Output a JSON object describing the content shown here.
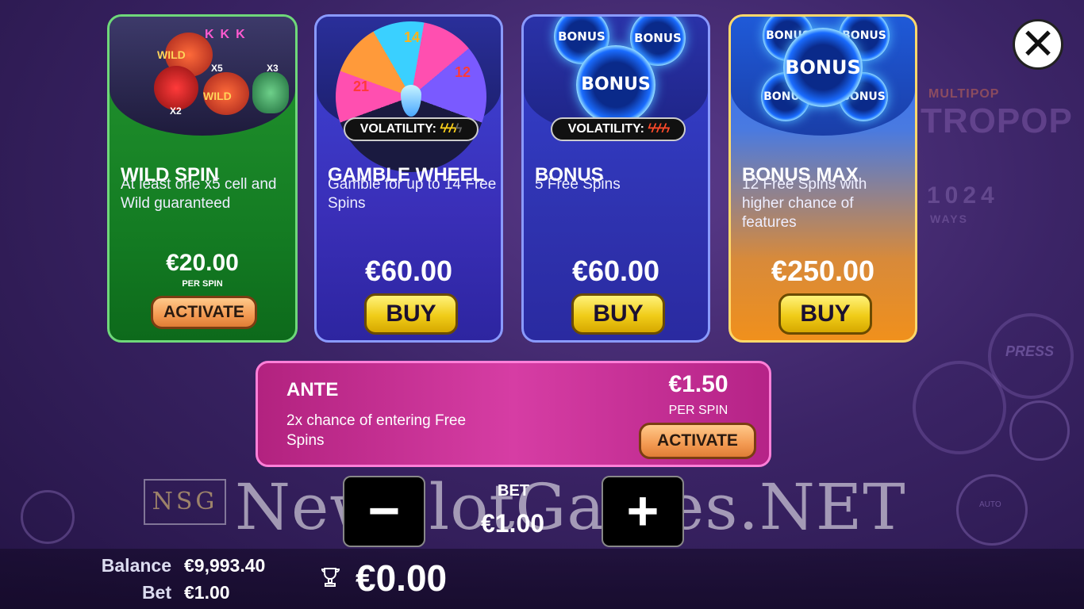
{
  "background": {
    "logo_top": "MULTIPOP",
    "logo_text": "TROPOP",
    "ways_number": "1024",
    "ways_label": "WAYS",
    "press_label": "PRESS",
    "auto_label": "AUTO"
  },
  "cards": [
    {
      "title": "WILD SPIN",
      "description": "At least one x5 cell and Wild guaranteed",
      "price": "€20.00",
      "price_sub": "PER SPIN",
      "button": "ACTIVATE",
      "art_labels": [
        "WILD",
        "WILD",
        "X5",
        "X3",
        "X2"
      ]
    },
    {
      "title": "GAMBLE WHEEL",
      "description": "Gamble for up to 14 Free Spins",
      "price": "€60.00",
      "button": "BUY",
      "volatility_label": "VOLATILITY:",
      "volatility_icon": "lightning-bolts-yellow",
      "volatility_level": 3.5,
      "wheel_labels": [
        "21",
        "14",
        "12"
      ]
    },
    {
      "title": "BONUS",
      "description": "5 Free Spins",
      "price": "€60.00",
      "button": "BUY",
      "volatility_label": "VOLATILITY:",
      "volatility_icon": "lightning-bolts-red",
      "volatility_level": 4,
      "chip_label": "BONUS"
    },
    {
      "title": "BONUS MAX",
      "description": "12 Free Spins with higher chance of features",
      "price": "€250.00",
      "button": "BUY",
      "chip_label": "BONUS"
    }
  ],
  "ante": {
    "title": "ANTE",
    "description": "2x chance of entering Free Spins",
    "price": "€1.50",
    "price_sub": "PER SPIN",
    "button": "ACTIVATE"
  },
  "bet_control": {
    "label": "BET",
    "value": "€1.00",
    "minus": "−",
    "plus": "+"
  },
  "footer": {
    "balance_label": "Balance",
    "balance_value": "€9,993.40",
    "bet_label": "Bet",
    "bet_value": "€1.00",
    "win_value": "€0.00",
    "win_icon": "trophy-icon"
  },
  "watermark": {
    "logo": "NSG",
    "text": "NewSlotGames.NET"
  },
  "colors": {
    "wild_card": "#1d8a2a",
    "gamble_card": "#3a3bc8",
    "bonus_card": "#2e3ab8",
    "bonus_max_card": "#f08a1c",
    "ante_bar": "#c8309a",
    "buy_button": "#f5d324",
    "activate_button": "#f39a52"
  }
}
